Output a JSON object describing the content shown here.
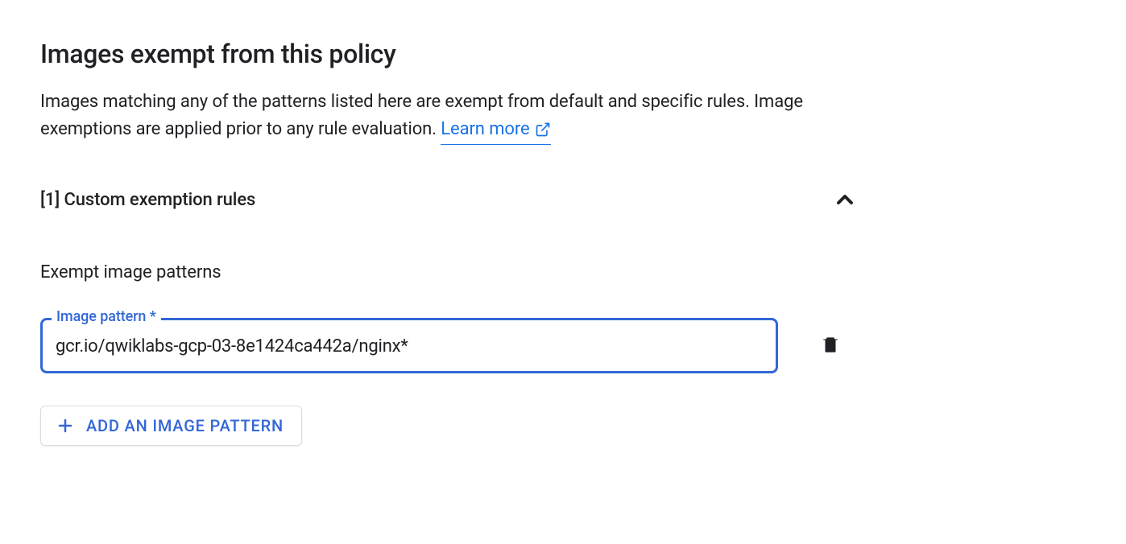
{
  "section": {
    "title": "Images exempt from this policy",
    "description": "Images matching any of the patterns listed here are exempt from default and specific rules. Image exemptions are applied prior to any rule evaluation. ",
    "learn_more": "Learn more"
  },
  "exemption": {
    "rules_title": "[1] Custom exemption rules",
    "patterns_title": "Exempt image patterns",
    "input_label": "Image pattern *",
    "input_value": "gcr.io/qwiklabs-gcp-03-8e1424ca442a/nginx*"
  },
  "buttons": {
    "add_pattern": "ADD AN IMAGE PATTERN"
  }
}
